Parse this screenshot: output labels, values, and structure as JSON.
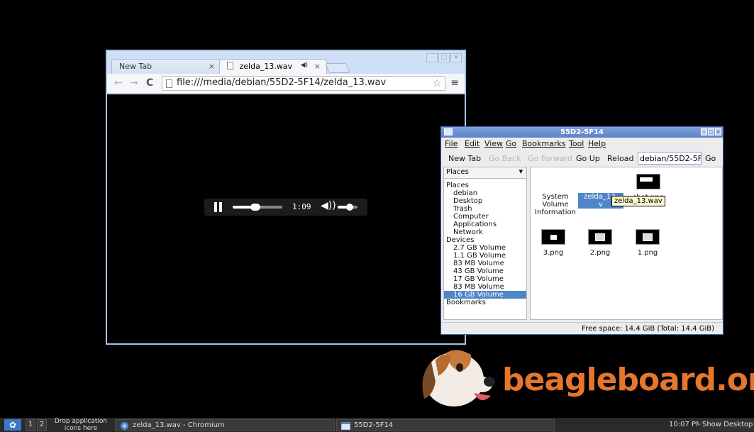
{
  "chrome": {
    "tabs": [
      {
        "title": "New Tab",
        "close": "×"
      },
      {
        "title": "zelda_13.wav",
        "close": "×",
        "speaker": "◀)"
      }
    ],
    "window_buttons": [
      "–",
      "□",
      "×"
    ],
    "nav": {
      "back": "←",
      "forward": "→",
      "reload": "C"
    },
    "url": "file:///media/debian/55D2-5F14/zelda_13.wav",
    "star": "☆",
    "menu": "≡",
    "player": {
      "time": "1:09",
      "progress": 0.45,
      "volume": 0.6,
      "volume_icon": "◀))"
    }
  },
  "fm": {
    "title": "55D2-5F14",
    "menu": [
      "File",
      "Edit",
      "View",
      "Go",
      "Bookmarks",
      "Tool",
      "Help"
    ],
    "toolbar": {
      "new_tab": "New Tab",
      "go_back": "Go Back",
      "go_forward": "Go Forward",
      "go_up": "Go Up",
      "reload": "Reload",
      "path": "debian/55D2-5F14",
      "go": "Go"
    },
    "places_dropdown": "Places",
    "tree": {
      "places_header": "Places",
      "places": [
        "debian",
        "Desktop",
        "Trash",
        "Computer",
        "Applications",
        "Network"
      ],
      "devices_header": "Devices",
      "devices": [
        "2.7 GB Volume",
        "1.1 GB Volume",
        "83 MB Volume",
        "43 GB Volume",
        "17 GB Volume",
        "83 MB Volume",
        "16 GB Volume"
      ],
      "selected_device": "16 GB Volume",
      "bookmarks_header": "Bookmarks"
    },
    "items": {
      "system_volume": "System\nVolume\nInformation",
      "zelda": "zelda_13.\nv",
      "shot": "shot.png",
      "png3": "3.png",
      "png2": "2.png",
      "png1": "1.png"
    },
    "tooltip": "zelda_13.wav",
    "status": "Free space: 14.4 GiB (Total: 14.4 GiB)"
  },
  "logo": {
    "brand": "beagleboard.org"
  },
  "taskbar": {
    "workspace1": "1",
    "workspace2": "2",
    "drop_hint": "Drop application icons here",
    "task_chromium": "zelda_13.wav - Chromium",
    "task_fm": "55D2-5F14",
    "clock": "10:07 PM",
    "show_desktop": "Show Desktop"
  },
  "colors": {
    "accent": "#3b63a8",
    "brand": "#e5762b",
    "selection": "#4f86c7"
  }
}
